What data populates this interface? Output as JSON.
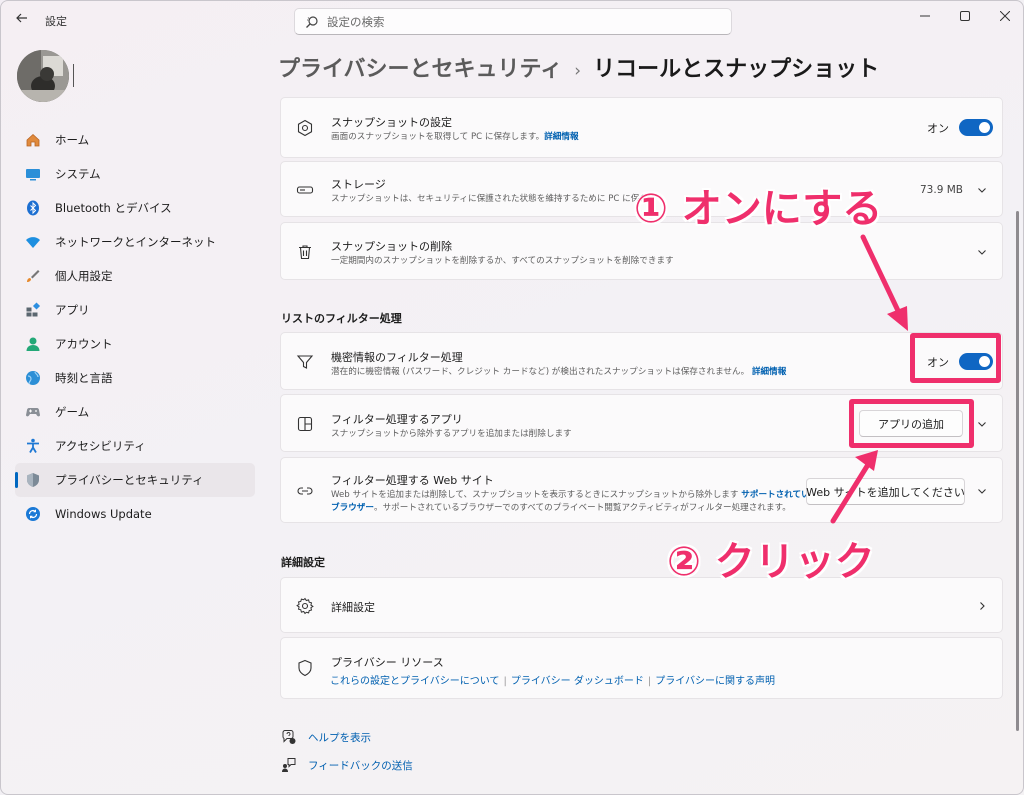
{
  "window": {
    "app_title": "設定",
    "search_placeholder": "設定の検索"
  },
  "sidebar": {
    "items": [
      {
        "label": "ホーム",
        "icon": "home-icon"
      },
      {
        "label": "システム",
        "icon": "system-icon"
      },
      {
        "label": "Bluetooth とデバイス",
        "icon": "bluetooth-icon"
      },
      {
        "label": "ネットワークとインターネット",
        "icon": "wifi-icon"
      },
      {
        "label": "個人用設定",
        "icon": "brush-icon"
      },
      {
        "label": "アプリ",
        "icon": "apps-icon"
      },
      {
        "label": "アカウント",
        "icon": "account-icon"
      },
      {
        "label": "時刻と言語",
        "icon": "time-language-icon"
      },
      {
        "label": "ゲーム",
        "icon": "gamepad-icon"
      },
      {
        "label": "アクセシビリティ",
        "icon": "accessibility-icon"
      },
      {
        "label": "プライバシーとセキュリティ",
        "icon": "shield-icon",
        "active": true
      },
      {
        "label": "Windows Update",
        "icon": "windows-update-icon"
      }
    ]
  },
  "breadcrumb": {
    "parent": "プライバシーとセキュリティ",
    "separator": "›",
    "current": "リコールとスナップショット"
  },
  "cards": {
    "snapshot_settings": {
      "title": "スナップショットの設定",
      "desc": "画面のスナップショットを取得して PC に保存します。",
      "link": "詳細情報",
      "toggle_label": "オン",
      "toggle_on": true
    },
    "storage": {
      "title": "ストレージ",
      "desc": "スナップショットは、セキュリティに保護された状態を維持するために PC に保存",
      "value": "73.9 MB"
    },
    "delete": {
      "title": "スナップショットの削除",
      "desc": "一定期間内のスナップショットを削除するか、すべてのスナップショットを削除できます"
    }
  },
  "filter_section": {
    "heading": "リストのフィルター処理",
    "sensitive": {
      "title": "機密情報のフィルター処理",
      "desc": "潜在的に機密情報 (パスワード、クレジット カードなど) が検出されたスナップショットは保存されません。",
      "link": "詳細情報",
      "toggle_label": "オン",
      "toggle_on": true
    },
    "apps": {
      "title": "フィルター処理するアプリ",
      "desc": "スナップショットから除外するアプリを追加または削除します",
      "button": "アプリの追加"
    },
    "websites": {
      "title": "フィルター処理する Web サイト",
      "desc1": "Web サイトを追加または削除して、スナップショットを表示するときにスナップショットから除外します",
      "link1a": "サポートされている",
      "link1b": "ブラウザー",
      "desc2": "。サポートされているブラウザーでのすべてのプライベート閲覧アクティビティがフィルター処理されます。",
      "button": "Web サイトを追加してください"
    }
  },
  "advanced_section": {
    "heading": "詳細設定",
    "advanced": {
      "title": "詳細設定"
    },
    "privacy": {
      "title": "プライバシー リソース",
      "links": [
        "これらの設定とプライバシーについて",
        "プライバシー ダッシュボード",
        "プライバシーに関する声明"
      ]
    }
  },
  "help": {
    "get_help": "ヘルプを表示",
    "feedback": "フィードバックの送信"
  },
  "annotations": {
    "step1": "① オンにする",
    "step2": "② クリック",
    "color": "#ef2f6c"
  },
  "colors": {
    "accent": "#0f66c3",
    "link": "#0060b0"
  }
}
